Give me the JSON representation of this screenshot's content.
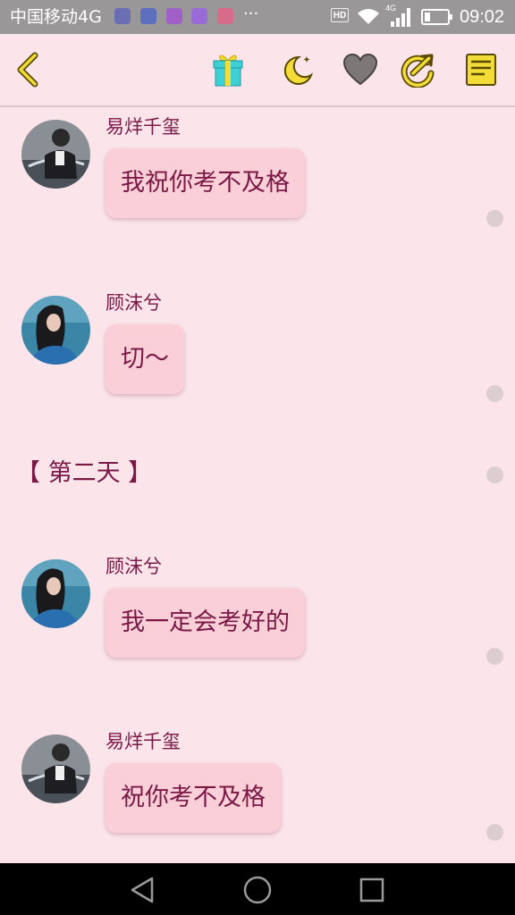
{
  "status_bar": {
    "carrier": "中国移动4G",
    "more": "···",
    "hd": "HD",
    "network": "4G",
    "time": "09:02",
    "icons": [
      "qq-icon",
      "shoe-icon",
      "image-icon",
      "keyboard-icon",
      "game-icon"
    ]
  },
  "toolbar": {
    "back_icon": "chevron-left-icon",
    "icons": [
      "gift-icon",
      "moon-icon",
      "heart-icon",
      "share-icon",
      "notes-icon"
    ],
    "colors": {
      "accent": "#f3dc37",
      "outline": "#5a4a00",
      "heart": "#7d7877",
      "gift": "#3fd0d6"
    }
  },
  "messages": [
    {
      "type": "chat",
      "sender": "易烊千玺",
      "text": "我祝你考不及格",
      "avatar": "male"
    },
    {
      "type": "chat",
      "sender": "顾沫兮",
      "text": "切～",
      "avatar": "female"
    },
    {
      "type": "narration",
      "text": "【 第二天 】"
    },
    {
      "type": "chat",
      "sender": "顾沫兮",
      "text": "我一定会考好的",
      "avatar": "female"
    },
    {
      "type": "chat",
      "sender": "易烊千玺",
      "text": "祝你考不及格",
      "avatar": "male"
    }
  ],
  "colors": {
    "background": "#fbe4ea",
    "bubble": "#fbcfd7",
    "text": "#7a1846",
    "status_bar": "#9a9799",
    "nav_bar": "#000000"
  },
  "nav_bar": {
    "icons": [
      "back-triangle-icon",
      "home-circle-icon",
      "recents-square-icon"
    ]
  }
}
